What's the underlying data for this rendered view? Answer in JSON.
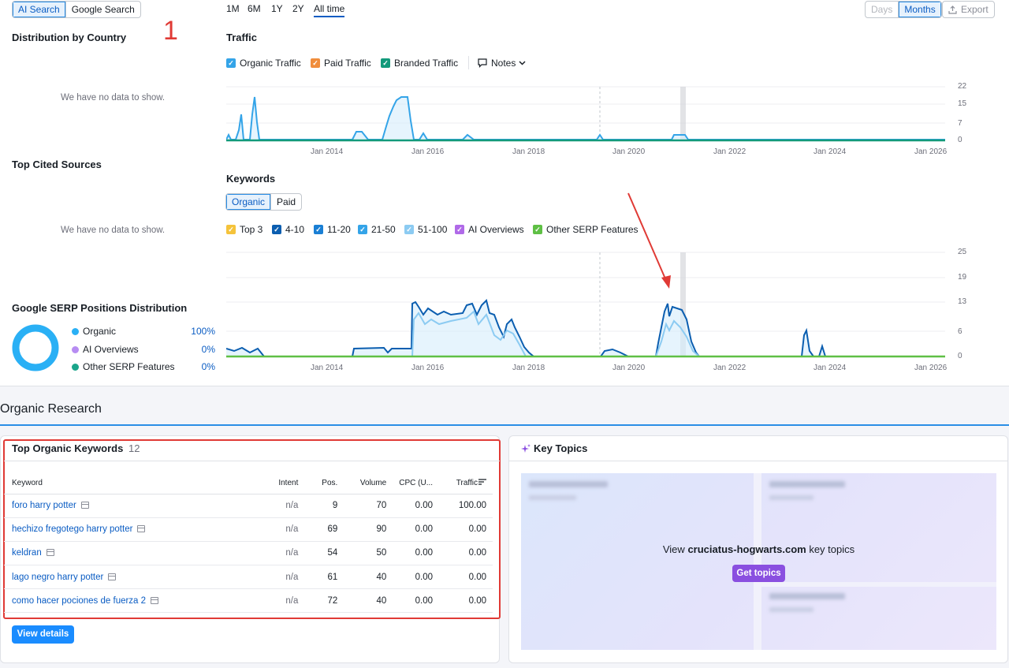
{
  "search_toggle": {
    "ai": "AI Search",
    "google": "Google Search"
  },
  "range_tabs": [
    "1M",
    "6M",
    "1Y",
    "2Y",
    "All time"
  ],
  "period_toggle": {
    "days": "Days",
    "months": "Months"
  },
  "export_label": "Export",
  "annotation_number": "1",
  "distribution": {
    "title": "Distribution by Country",
    "empty": "We have no data to show."
  },
  "cited": {
    "title": "Top Cited Sources",
    "empty": "We have no data to show."
  },
  "serp_dist": {
    "title": "Google SERP Positions Distribution",
    "rows": [
      {
        "label": "Organic",
        "pct": "100%",
        "color": "#2ab0f5"
      },
      {
        "label": "AI Overviews",
        "pct": "0%",
        "color": "#b78cf2"
      },
      {
        "label": "Other SERP Features",
        "pct": "0%",
        "color": "#1aa58a"
      }
    ]
  },
  "traffic": {
    "title": "Traffic",
    "legend": [
      {
        "label": "Organic Traffic",
        "color": "#34a4e8"
      },
      {
        "label": "Paid Traffic",
        "color": "#f08d3c"
      },
      {
        "label": "Branded Traffic",
        "color": "#139a7b"
      }
    ],
    "notes": "Notes",
    "y_ticks": [
      "22",
      "15",
      "7",
      "0"
    ],
    "x_ticks": [
      "Jan 2014",
      "Jan 2016",
      "Jan 2018",
      "Jan 2020",
      "Jan 2022",
      "Jan 2024",
      "Jan 2026"
    ]
  },
  "keywords": {
    "title": "Keywords",
    "tabs": {
      "organic": "Organic",
      "paid": "Paid"
    },
    "legend": [
      {
        "label": "Top 3",
        "color": "#f5c33b"
      },
      {
        "label": "4-10",
        "color": "#0b5eb0"
      },
      {
        "label": "11-20",
        "color": "#1a7fd4"
      },
      {
        "label": "21-50",
        "color": "#34a4e8"
      },
      {
        "label": "51-100",
        "color": "#8ccbf2"
      },
      {
        "label": "AI Overviews",
        "color": "#b06ae8"
      },
      {
        "label": "Other SERP Features",
        "color": "#5fc045"
      }
    ],
    "y_ticks": [
      "25",
      "19",
      "13",
      "6",
      "0"
    ],
    "x_ticks": [
      "Jan 2014",
      "Jan 2016",
      "Jan 2018",
      "Jan 2020",
      "Jan 2022",
      "Jan 2024",
      "Jan 2026"
    ]
  },
  "organic_research": {
    "title": "Organic Research"
  },
  "top_keywords": {
    "title": "Top Organic Keywords",
    "count": "12",
    "columns": [
      "Keyword",
      "Intent",
      "Pos.",
      "Volume",
      "CPC (U...",
      "Traffic"
    ],
    "rows": [
      {
        "keyword": "foro harry potter",
        "intent": "n/a",
        "pos": "9",
        "volume": "70",
        "cpc": "0.00",
        "traffic": "100.00"
      },
      {
        "keyword": "hechizo fregotego harry potter",
        "intent": "n/a",
        "pos": "69",
        "volume": "90",
        "cpc": "0.00",
        "traffic": "0.00"
      },
      {
        "keyword": "keldran",
        "intent": "n/a",
        "pos": "54",
        "volume": "50",
        "cpc": "0.00",
        "traffic": "0.00"
      },
      {
        "keyword": "lago negro harry potter",
        "intent": "n/a",
        "pos": "61",
        "volume": "40",
        "cpc": "0.00",
        "traffic": "0.00"
      },
      {
        "keyword": "como hacer pociones de fuerza 2",
        "intent": "n/a",
        "pos": "72",
        "volume": "40",
        "cpc": "0.00",
        "traffic": "0.00"
      }
    ],
    "view_details": "View details"
  },
  "key_topics": {
    "title": "Key Topics",
    "view_prefix": "View",
    "domain": "cruciatus-hogwarts.com",
    "view_suffix": "key topics",
    "get_topics": "Get topics"
  }
}
